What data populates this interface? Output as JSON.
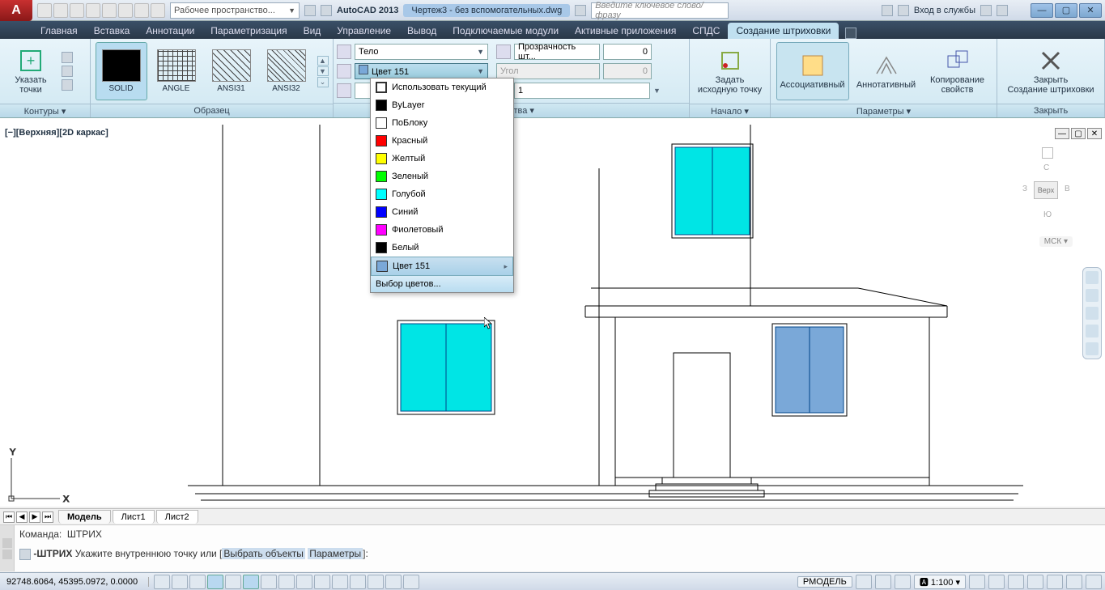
{
  "title": {
    "app": "AutoCAD 2013",
    "file": "Чертеж3 - без вспомогательных.dwg"
  },
  "qat": {
    "workspace": "Рабочее пространство..."
  },
  "search": {
    "placeholder": "Введите ключевое слово/фразу"
  },
  "signin": "Вход в службы",
  "tabs": [
    "Главная",
    "Вставка",
    "Аннотации",
    "Параметризация",
    "Вид",
    "Управление",
    "Вывод",
    "Подключаемые модули",
    "Активные приложения",
    "СПДС",
    "Создание штриховки"
  ],
  "active_tab_index": 10,
  "panels": {
    "contours": {
      "title": "Контуры ▾",
      "pick": "Указать точки"
    },
    "pattern": {
      "title": "Образец",
      "items": [
        "SOLID",
        "ANGLE",
        "ANSI31",
        "ANSI32"
      ]
    },
    "props": {
      "title": "Свойства ▾",
      "type": "Тело",
      "color": "Цвет 151",
      "trans_label": "Прозрачность шт...",
      "trans_val": "0",
      "angle_label": "Угол",
      "angle_val": "0",
      "scale": "1"
    },
    "origin": {
      "title": "Начало ▾",
      "btn1": "Задать",
      "btn2": "исходную точку"
    },
    "params": {
      "title": "Параметры ▾",
      "assoc": "Ассоциативный",
      "annot": "Аннотативный",
      "copy1": "Копирование",
      "copy2": "свойств"
    },
    "close": {
      "title": "Закрыть",
      "btn1": "Закрыть",
      "btn2": "Создание штриховки"
    }
  },
  "color_dd": {
    "items": [
      {
        "label": "Использовать текущий",
        "color": "#fff",
        "border": "#333"
      },
      {
        "label": "ByLayer",
        "color": "#000"
      },
      {
        "label": "ПоБлоку",
        "color": "#fff"
      },
      {
        "label": "Красный",
        "color": "#f00"
      },
      {
        "label": "Желтый",
        "color": "#ff0"
      },
      {
        "label": "Зеленый",
        "color": "#0f0"
      },
      {
        "label": "Голубой",
        "color": "#0ff"
      },
      {
        "label": "Синий",
        "color": "#00f"
      },
      {
        "label": "Фиолетовый",
        "color": "#f0f"
      },
      {
        "label": "Белый",
        "color": "#000"
      },
      {
        "label": "Цвет 151",
        "color": "#7aa8d8"
      }
    ],
    "more": "Выбор цветов..."
  },
  "view": {
    "label": "[−][Верхняя][2D каркас]",
    "cube_face": "Верх",
    "cs": "МСК"
  },
  "modeltabs": [
    "Модель",
    "Лист1",
    "Лист2"
  ],
  "cmd": {
    "line1_label": "Команда:",
    "line1_cmd": "ШТРИХ",
    "line2_cmd": "-ШТРИХ",
    "line2_text": "Укажите внутреннюю точку или [",
    "line2_opt1": "Выбрать объекты",
    "line2_opt2": "Параметры",
    "line2_end": "]:"
  },
  "status": {
    "coords": "92748.6064, 45395.0972, 0.0000",
    "space": "РМОДЕЛЬ",
    "scale": "1:100"
  },
  "compass": {
    "n": "С",
    "s": "Ю",
    "e": "В",
    "w": "З"
  }
}
